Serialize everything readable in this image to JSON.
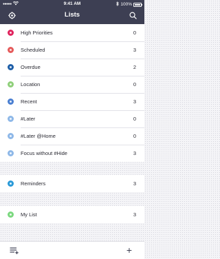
{
  "status_bar": {
    "signal": "●●●●●",
    "carrier": "",
    "time": "9:41 AM",
    "battery": "100%"
  },
  "header": {
    "title": "Lists",
    "settings_icon": "gear-icon",
    "search_icon": "search-icon"
  },
  "lists_group_1": [
    {
      "label": "High Priorities",
      "count": "0",
      "color": "#e0245e"
    },
    {
      "label": "Scheduled",
      "count": "3",
      "color": "#e55a5a"
    },
    {
      "label": "Overdue",
      "count": "2",
      "color": "#1e5fa8"
    },
    {
      "label": "Location",
      "count": "0",
      "color": "#8fcf7a"
    },
    {
      "label": "Recent",
      "count": "3",
      "color": "#4a7fd1"
    },
    {
      "label": "#Later",
      "count": "0",
      "color": "#8eb8e8"
    },
    {
      "label": "#Later @Home",
      "count": "0",
      "color": "#8eb8e8"
    },
    {
      "label": "Focus without #Hide",
      "count": "3",
      "color": "#8eb8e8"
    }
  ],
  "lists_group_2": [
    {
      "label": "Reminders",
      "count": "3",
      "color": "#2a9ad8"
    }
  ],
  "lists_group_3": [
    {
      "label": "My List",
      "count": "3",
      "color": "#7bd87f"
    }
  ],
  "toolbar": {
    "menu_icon": "list-menu-icon",
    "add_label": "+"
  },
  "colors": {
    "header_bg": "#3d3f53",
    "page_bg": "#f4f4f7"
  }
}
